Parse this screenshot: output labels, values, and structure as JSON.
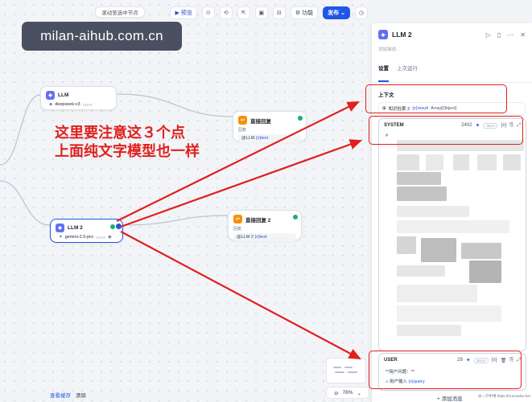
{
  "canvas": {
    "hint": "滚动至选中节点",
    "watermark": "milan-aihub.com.cn",
    "toolbar": {
      "preview_label": "预览",
      "feature_label": "功能",
      "publish_label": "发布"
    },
    "annotation": {
      "line1": "这里要注意这３个点",
      "line2": "上面纯文字模型也一样"
    },
    "nodes": {
      "llm1": {
        "title": "LLM",
        "model": "deepseek-v3",
        "tag": "CHAT"
      },
      "reply1": {
        "title": "直接回复",
        "sub": "回复",
        "var_prefix": "@LLM",
        "var_name": "{x}text"
      },
      "llm2": {
        "title": "LLM 2",
        "model": "gemini-2.5-pro",
        "tag": "CHAT"
      },
      "reply2": {
        "title": "直接回复 2",
        "sub": "回复",
        "var_prefix": "@LLM 2",
        "var_name": "{x}text"
      }
    },
    "bottom": {
      "view_cache": "查看缓存",
      "clear": "清除"
    },
    "zoom": "78%"
  },
  "panel": {
    "title": "LLM 2",
    "desc_placeholder": "添加描述...",
    "tabs": [
      "设置",
      "上次运行"
    ],
    "context": {
      "label": "上下文",
      "source": "知识检索 2",
      "var": "{x}result",
      "type": "Array[Object]"
    },
    "system": {
      "role": "SYSTEM",
      "count": "2402",
      "jinja": "JINJA",
      "first_line": "#"
    },
    "user": {
      "role": "USER",
      "count": "29",
      "line1": "**用户问题：**",
      "var_prefix": "用户输入",
      "var_name": "{x}query"
    },
    "add_message": "添加消息",
    "credit": "@一只牛博 https://hi.acowbo.fun"
  },
  "colors": {
    "accent": "#2156e8",
    "annotation_red": "#e0201d",
    "llm_icon": "#6171f5",
    "reply_icon": "#f79009",
    "success": "#17b26a"
  }
}
